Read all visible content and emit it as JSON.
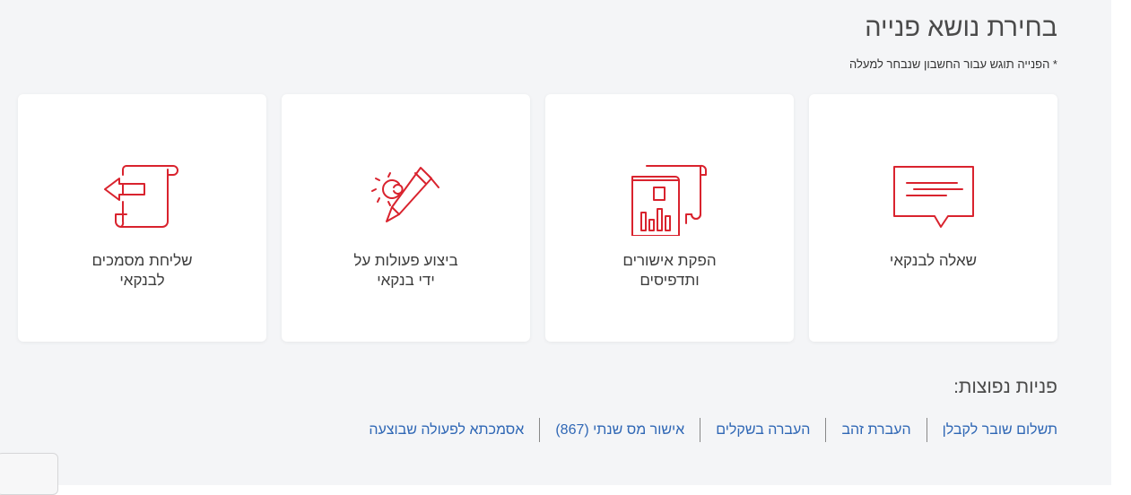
{
  "header": {
    "title": "בחירת נושא פנייה",
    "subtitle": "* הפנייה תוגש עבור החשבון שנבחר למעלה"
  },
  "cards": [
    {
      "label": "שאלה לבנקאי",
      "icon": "chat-bubble-icon"
    },
    {
      "label": "הפקת אישורים\nותדפיסים",
      "icon": "document-chart-icon"
    },
    {
      "label": "ביצוע פעולות על\nידי בנקאי",
      "icon": "pencil-gear-icon"
    },
    {
      "label": "שליחת מסמכים\nלבנקאי",
      "icon": "scroll-send-icon"
    }
  ],
  "faq": {
    "title": "פניות נפוצות:",
    "links": [
      "אסמכתא לפעולה שבוצעה",
      "אישור מס שנתי (867)",
      "העברה בשקלים",
      "העברת זהב",
      "תשלום שובר לקבלן"
    ]
  },
  "colors": {
    "accent": "#d9232e",
    "link": "#2f67b5",
    "background": "#f4f5f7"
  }
}
